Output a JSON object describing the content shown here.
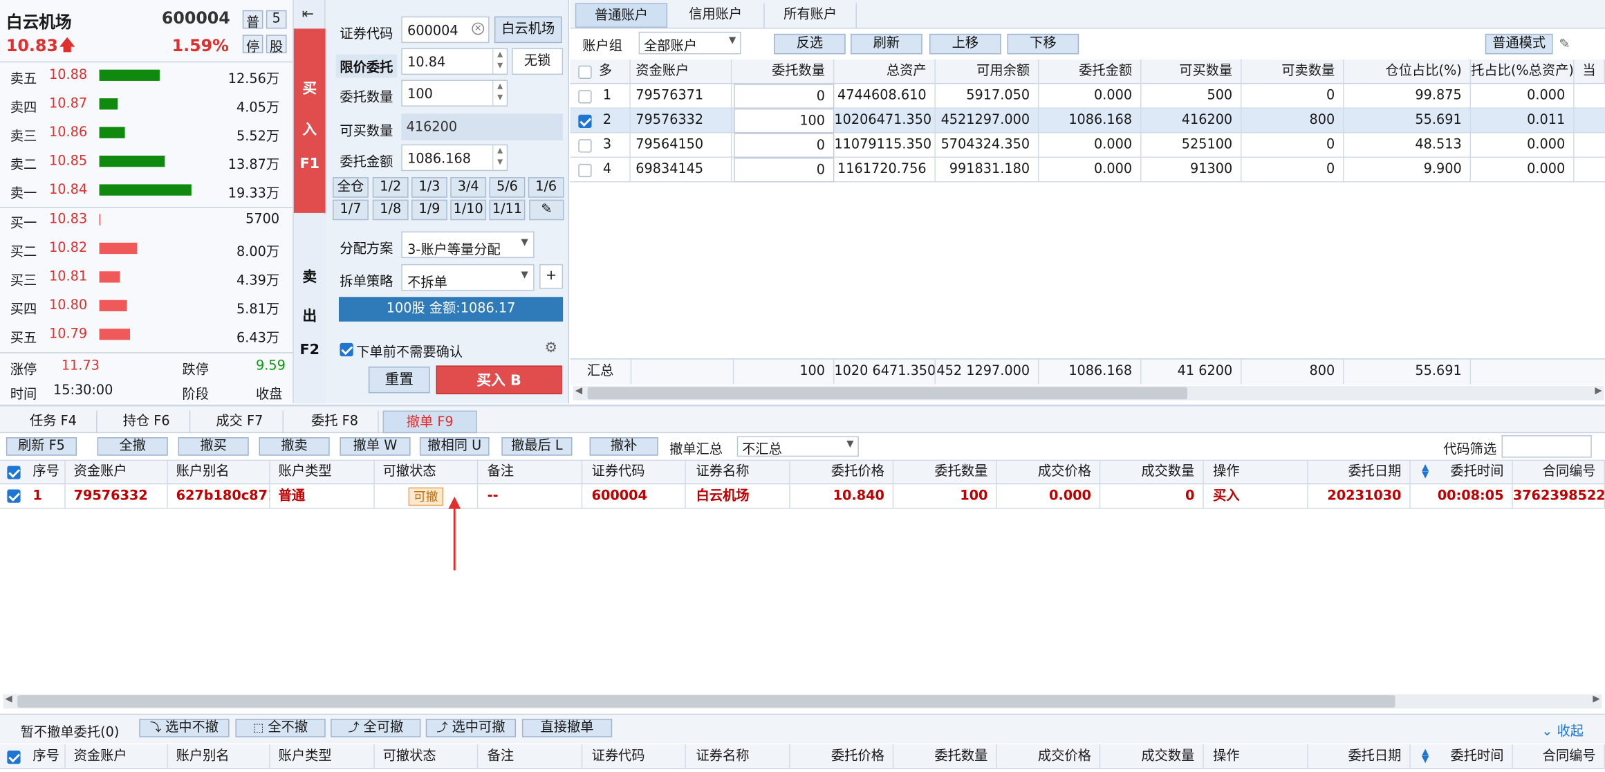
{
  "quote": {
    "name": "白云机场",
    "code": "600004",
    "tag1": "普",
    "tag2": "5",
    "tag3": "停",
    "tag4": "股",
    "price": "10.83",
    "change_pct": "1.59%",
    "asks": [
      {
        "label": "卖五",
        "price": "10.88",
        "vol": "12.56万",
        "bar": 0.65
      },
      {
        "label": "卖四",
        "price": "10.87",
        "vol": "4.05万",
        "bar": 0.2
      },
      {
        "label": "卖三",
        "price": "10.86",
        "vol": "5.52万",
        "bar": 0.28
      },
      {
        "label": "卖二",
        "price": "10.85",
        "vol": "13.87万",
        "bar": 0.71
      },
      {
        "label": "卖一",
        "price": "10.84",
        "vol": "19.33万",
        "bar": 1.0
      }
    ],
    "bids": [
      {
        "label": "买一",
        "price": "10.83",
        "vol": "5700",
        "bar": 0.0
      },
      {
        "label": "买二",
        "price": "10.82",
        "vol": "8.00万",
        "bar": 0.41
      },
      {
        "label": "买三",
        "price": "10.81",
        "vol": "4.39万",
        "bar": 0.22
      },
      {
        "label": "买四",
        "price": "10.80",
        "vol": "5.81万",
        "bar": 0.3
      },
      {
        "label": "买五",
        "price": "10.79",
        "vol": "6.43万",
        "bar": 0.33
      }
    ],
    "limit_up_label": "涨停",
    "limit_up": "11.73",
    "limit_down_label": "跌停",
    "limit_down": "9.59",
    "time_label": "时间",
    "time": "15:30:00",
    "stage_label": "阶段",
    "stage": "收盘"
  },
  "side": {
    "collapse": "⇤",
    "buy": [
      "买",
      "入",
      "F1"
    ],
    "sell": [
      "卖",
      "出",
      "F2"
    ]
  },
  "order": {
    "code_label": "证券代码",
    "code": "600004",
    "name_btn": "白云机场",
    "price_label": "限价委托",
    "price": "10.84",
    "lock": "无锁",
    "qty_label": "委托数量",
    "qty": "100",
    "buyable_label": "可买数量",
    "buyable": "416200",
    "amount_label": "委托金额",
    "amount": "1086.168",
    "fracs": [
      "全仓",
      "1/2",
      "1/3",
      "3/4",
      "5/6",
      "1/6",
      "1/7",
      "1/8",
      "1/9",
      "1/10",
      "1/11"
    ],
    "alloc_label": "分配方案",
    "alloc": "3-账户等量分配",
    "split_label": "拆单策略",
    "split": "不拆单",
    "plus": "+",
    "summary": "100股 金额:1086.17",
    "confirm": "下单前不需要确认",
    "reset": "重置",
    "submit": "买入 B"
  },
  "accounts": {
    "tabs": [
      "普通账户",
      "信用账户",
      "所有账户"
    ],
    "group_label": "账户组",
    "group": "全部账户",
    "btns": [
      "反选",
      "刷新",
      "上移",
      "下移"
    ],
    "mode": "普通模式",
    "headers": [
      "多",
      "资金账户",
      "委托数量",
      "总资产",
      "可用余额",
      "委托金额",
      "可买数量",
      "可卖数量",
      "仓位占比(%)",
      "托占比(%总资产)",
      "当"
    ],
    "rows": [
      {
        "checked": false,
        "idx": "1",
        "acct": "79576371",
        "qty": "0",
        "total": "4744608.610",
        "avail": "5917.050",
        "amt": "0.000",
        "buy": "500",
        "sell": "0",
        "pos": "99.875",
        "ratio": "0.000"
      },
      {
        "checked": true,
        "idx": "2",
        "acct": "79576332",
        "qty": "100",
        "total": "10206471.350",
        "avail": "4521297.000",
        "amt": "1086.168",
        "buy": "416200",
        "sell": "800",
        "pos": "55.691",
        "ratio": "0.011"
      },
      {
        "checked": false,
        "idx": "3",
        "acct": "79564150",
        "qty": "0",
        "total": "11079115.350",
        "avail": "5704324.350",
        "amt": "0.000",
        "buy": "525100",
        "sell": "0",
        "pos": "48.513",
        "ratio": "0.000"
      },
      {
        "checked": false,
        "idx": "4",
        "acct": "69834145",
        "qty": "0",
        "total": "1161720.756",
        "avail": "991831.180",
        "amt": "0.000",
        "buy": "91300",
        "sell": "0",
        "pos": "9.900",
        "ratio": "0.000"
      }
    ],
    "sum": {
      "label": "汇总",
      "qty": "100",
      "total": "1020 6471.350",
      "avail": "452 1297.000",
      "amt": "1086.168",
      "buy": "41 6200",
      "sell": "800",
      "pos": "55.691"
    }
  },
  "bottom": {
    "tabs": [
      "任务 F4",
      "持仓 F6",
      "成交 F7",
      "委托 F8",
      "撤单 F9"
    ],
    "btns": [
      "刷新 F5",
      "全撤",
      "撤买",
      "撤卖",
      "撤单 W",
      "撤相同 U",
      "撤最后 L",
      "撤补"
    ],
    "sum_label": "撤单汇总",
    "sum_val": "不汇总",
    "filter_label": "代码筛选",
    "headers": [
      "序号",
      "资金账户",
      "账户别名",
      "账户类型",
      "可撤状态",
      "备注",
      "证券代码",
      "证券名称",
      "委托价格",
      "委托数量",
      "成交价格",
      "成交数量",
      "操作",
      "委托日期",
      "委托时间",
      "合同编号"
    ],
    "row": {
      "idx": "1",
      "acct": "79576332",
      "alias": "627b180c871fc",
      "type": "普通",
      "status": "可撤",
      "note": "--",
      "code": "600004",
      "name": "白云机场",
      "price": "10.840",
      "qty": "100",
      "dprice": "0.000",
      "dqty": "0",
      "op": "买入",
      "date": "20231030",
      "time": "00:08:05",
      "contract": "3762398522"
    },
    "hold_label": "暂不撤单委托(0)",
    "hold_btns": [
      "选中不撤",
      "全不撤",
      "全可撤",
      "选中可撤",
      "直接撤单"
    ],
    "collapse": "收起"
  }
}
